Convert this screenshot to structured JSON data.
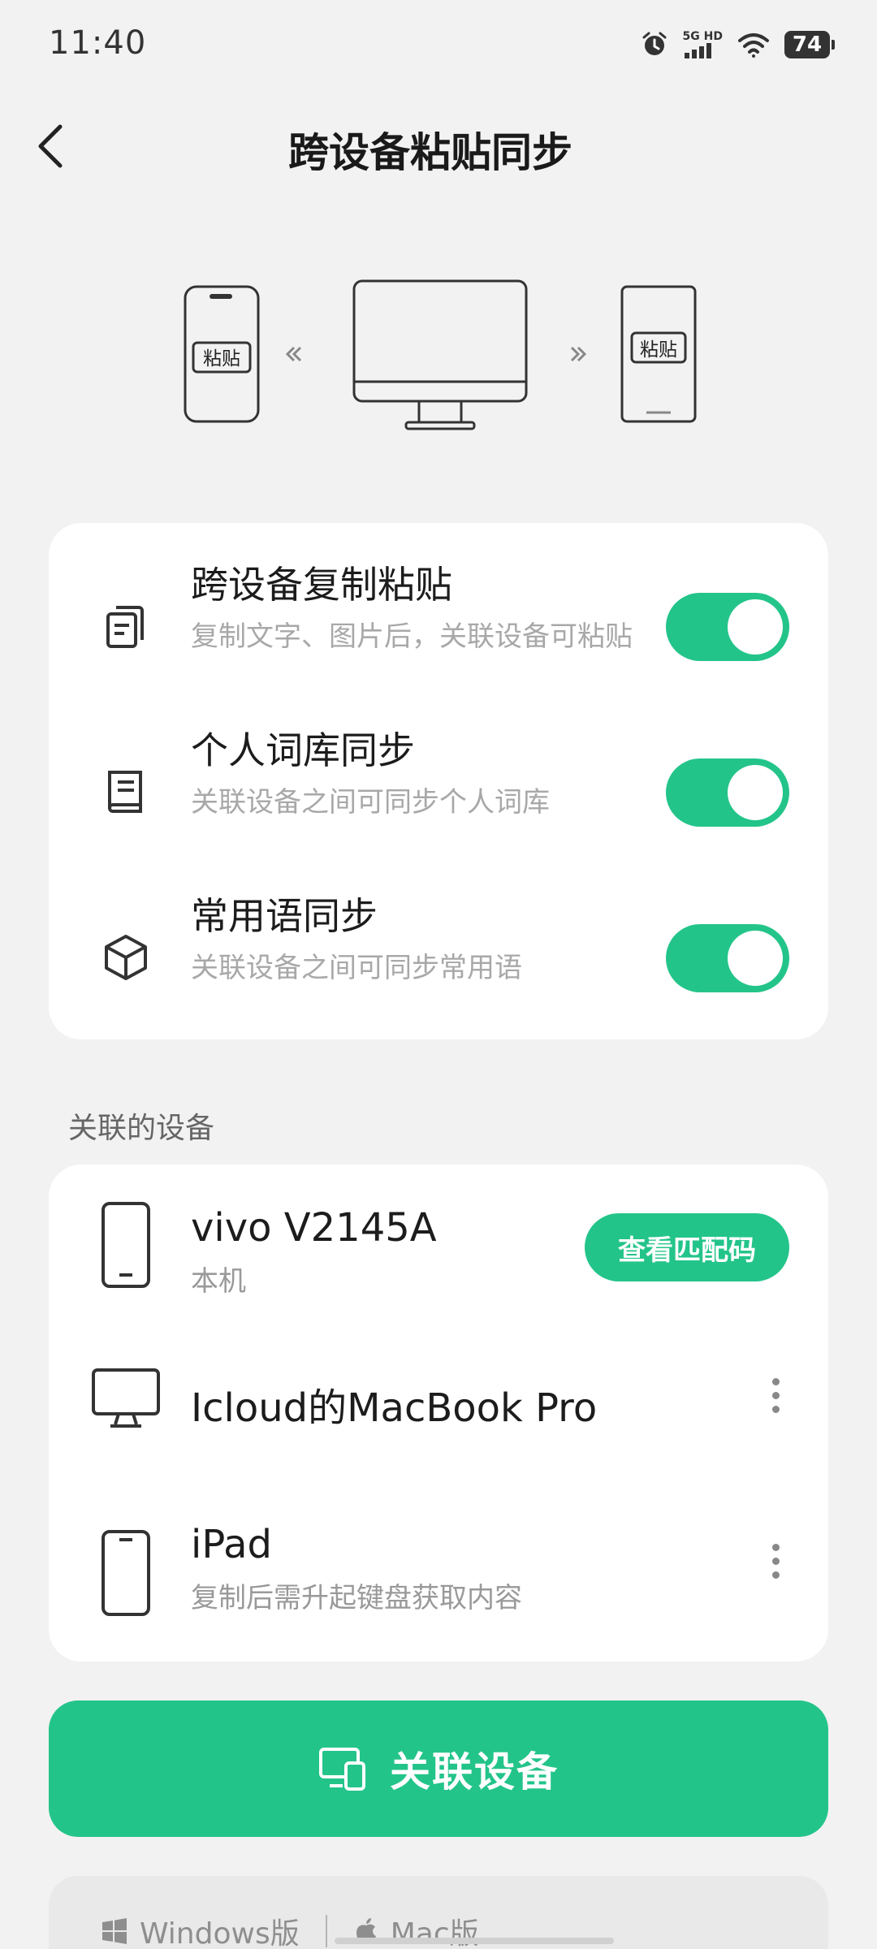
{
  "status_bar": {
    "time": "11:40",
    "network": "5G HD",
    "battery": "74"
  },
  "header": {
    "title": "跨设备粘贴同步"
  },
  "illustration": {
    "left_phone_label": "粘贴",
    "right_phone_label": "粘贴"
  },
  "features": [
    {
      "title": "跨设备复制粘贴",
      "subtitle": "复制文字、图片后，关联设备可粘贴",
      "icon": "copy-icon",
      "enabled": true
    },
    {
      "title": "个人词库同步",
      "subtitle": "关联设备之间可同步个人词库",
      "icon": "book-icon",
      "enabled": true
    },
    {
      "title": "常用语同步",
      "subtitle": "关联设备之间可同步常用语",
      "icon": "cube-icon",
      "enabled": true
    }
  ],
  "devices_section": {
    "label": "关联的设备"
  },
  "devices": [
    {
      "name": "vivo V2145A",
      "subtitle": "本机",
      "icon": "phone-icon",
      "action": "查看匹配码"
    },
    {
      "name": "Icloud的MacBook Pro",
      "subtitle": "",
      "icon": "monitor-icon"
    },
    {
      "name": "iPad",
      "subtitle": "复制后需升起键盘获取内容",
      "icon": "tablet-icon"
    }
  ],
  "primary_action": {
    "label": "关联设备",
    "icon": "link-devices-icon"
  },
  "downloads": {
    "windows": "Windows版",
    "mac": "Mac版"
  },
  "colors": {
    "accent": "#23c48a",
    "background": "#f2f2f2",
    "card": "#ffffff"
  }
}
